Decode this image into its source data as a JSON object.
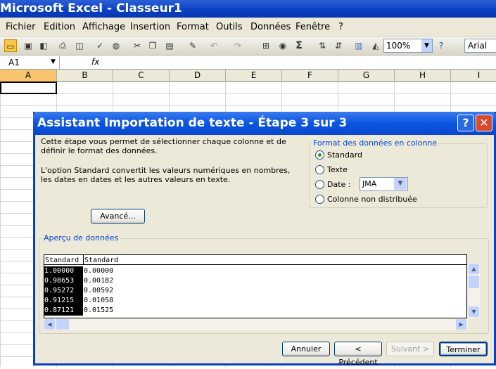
{
  "window": {
    "title": "Microsoft Excel - Classeur1"
  },
  "menu": [
    "Fichier",
    "Edition",
    "Affichage",
    "Insertion",
    "Format",
    "Outils",
    "Données",
    "Fenêtre",
    "?"
  ],
  "toolbar": {
    "zoom": "100%",
    "font": "Arial",
    "sigma": "Σ"
  },
  "formula": {
    "namebox": "A1",
    "fx": "fx"
  },
  "columns": [
    "A",
    "B",
    "C",
    "D",
    "E",
    "F",
    "G",
    "H",
    "I"
  ],
  "dialog": {
    "title": "Assistant Importation de texte - Étape 3 sur 3",
    "help": "?",
    "close": "✕",
    "intro1": "Cette étape vous permet de sélectionner chaque colonne et de",
    "intro2": "définir le format des données.",
    "intro3": "L'option Standard convertit les valeurs numériques en nombres,",
    "intro4": "les dates en dates et les autres valeurs en texte.",
    "advanced": "Avancé...",
    "format_group": "Format des données en colonne",
    "opt_standard": "Standard",
    "opt_text": "Texte",
    "opt_date": "Date :",
    "date_value": "JMA",
    "opt_skip": "Colonne non distribuée",
    "preview_group": "Aperçu de données",
    "preview_headers": [
      "Standard",
      "Standard"
    ],
    "preview_col1": [
      "1.00000",
      "0.98653",
      "0.95272",
      "0.91215",
      "0.87121"
    ],
    "preview_col2": [
      "0.00000",
      "0.00182",
      "0.00592",
      "0.01058",
      "0.01525"
    ],
    "btn_cancel": "Annuler",
    "btn_prev": "< Précédent",
    "btn_next": "Suivant >",
    "btn_finish": "Terminer"
  }
}
